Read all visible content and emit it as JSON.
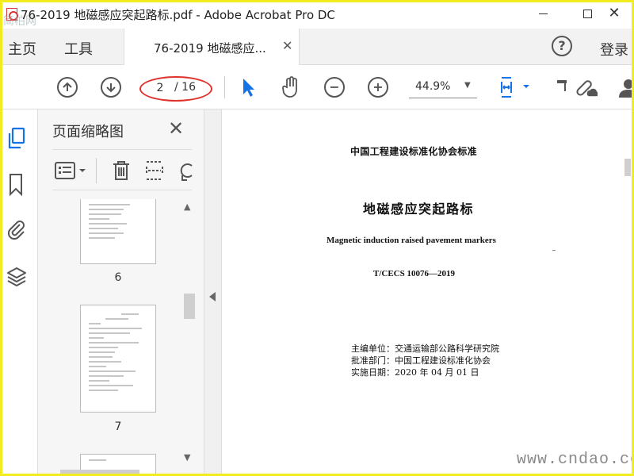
{
  "window": {
    "title": "76-2019 地磁感应突起路标.pdf - Adobe Acrobat Pro DC",
    "corner_watermark": "简柏网"
  },
  "menubar": {
    "home": "主页",
    "tools": "工具",
    "doc_tab": "76-2019 地磁感应...",
    "login": "登录"
  },
  "toolbar": {
    "current_page": "2",
    "total_pages": "/ 16",
    "zoom": "44.9%",
    "annotation_color": "#e0322c"
  },
  "thumbnail_panel": {
    "title": "页面缩略图",
    "thumbnails": [
      {
        "page": "6"
      },
      {
        "page": "7"
      }
    ]
  },
  "document": {
    "org": "中国工程建设标准化协会标准",
    "title_cn": "地磁感应突起路标",
    "title_en": "Magnetic induction raised pavement markers",
    "code": "T/CECS 10076—2019",
    "info": [
      "主编单位：交通运输部公路科学研究院",
      "批准部门：中国工程建设标准化协会",
      "实施日期：2020 年 04 月 01 日"
    ]
  },
  "watermark": "www.cndao.com",
  "colors": {
    "accent": "#1473e6",
    "frame": "#f2ec1e",
    "icon": "#555555"
  }
}
